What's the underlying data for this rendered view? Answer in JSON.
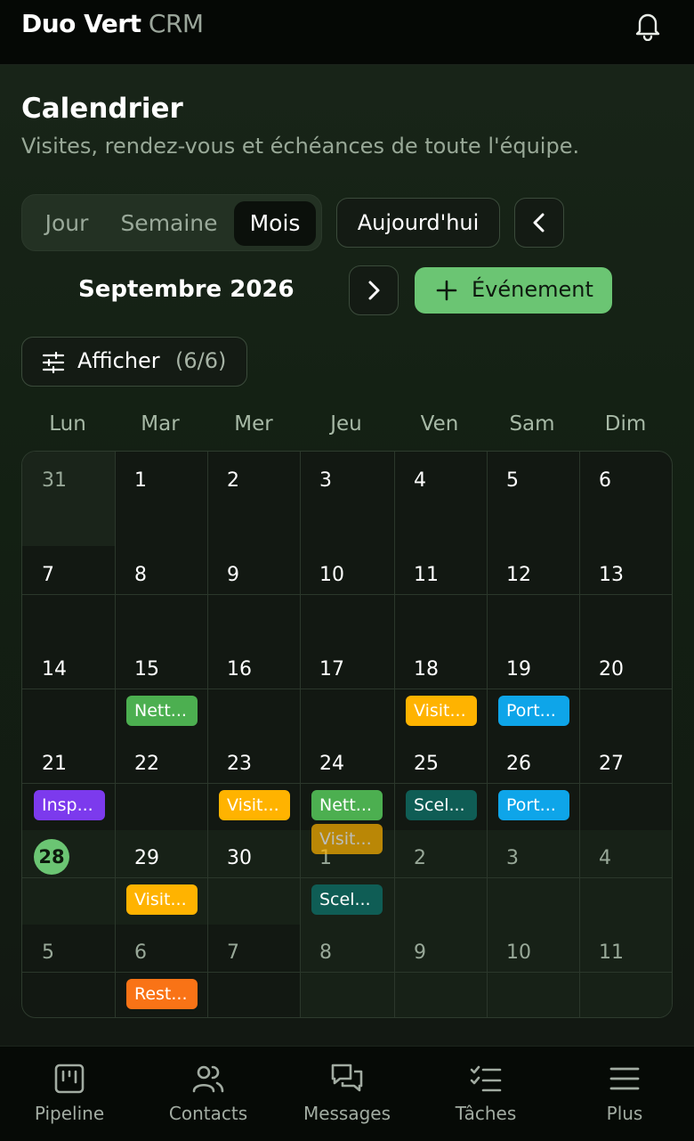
{
  "app": {
    "brand_bold": "Duo Vert",
    "brand_light": "CRM"
  },
  "header": {
    "title": "Calendrier",
    "subtitle": "Visites, rendez-vous et échéances de toute l'équipe."
  },
  "view_switcher": {
    "day": "Jour",
    "week": "Semaine",
    "month": "Mois",
    "selected": "Mois"
  },
  "toolbar": {
    "today": "Aujourd'hui",
    "current_month": "Septembre 2026",
    "new_event": "Événement",
    "filter_label": "Afficher",
    "filter_count": "(6/6)"
  },
  "weekdays": [
    "Lun",
    "Mar",
    "Mer",
    "Jeu",
    "Ven",
    "Sam",
    "Dim"
  ],
  "calendar": {
    "today": "28",
    "weeks": [
      [
        "31",
        "1",
        "2",
        "3",
        "4",
        "5",
        "6"
      ],
      [
        "7",
        "8",
        "9",
        "10",
        "11",
        "12",
        "13"
      ],
      [
        "14",
        "15",
        "16",
        "17",
        "18",
        "19",
        "20"
      ],
      [
        "21",
        "22",
        "23",
        "24",
        "25",
        "26",
        "27"
      ],
      [
        "28",
        "29",
        "30",
        "1",
        "2",
        "3",
        "4"
      ],
      [
        "5",
        "6",
        "7",
        "8",
        "9",
        "10",
        "11"
      ]
    ],
    "events": [
      {
        "label": "Nett...",
        "color": "#4caf50"
      },
      {
        "label": "Visit...",
        "color": "#ffb300"
      },
      {
        "label": "Port...",
        "color": "#0ea5e9"
      },
      {
        "label": "Insp...",
        "color": "#7c3aed"
      },
      {
        "label": "Visit...",
        "color": "#ffb300"
      },
      {
        "label": "Nett...",
        "color": "#4caf50"
      },
      {
        "label": "Visit...",
        "color": "#ffb300"
      },
      {
        "label": "Scel...",
        "color": "#0f5d55"
      },
      {
        "label": "Port...",
        "color": "#0ea5e9"
      },
      {
        "label": "Visit...",
        "color": "#ffb300"
      },
      {
        "label": "Scel...",
        "color": "#0f5d55"
      },
      {
        "label": "Rest...",
        "color": "#f97316"
      }
    ]
  },
  "bottom_nav": {
    "pipeline": "Pipeline",
    "contacts": "Contacts",
    "messages": "Messages",
    "tasks": "Tâches",
    "more": "Plus"
  }
}
